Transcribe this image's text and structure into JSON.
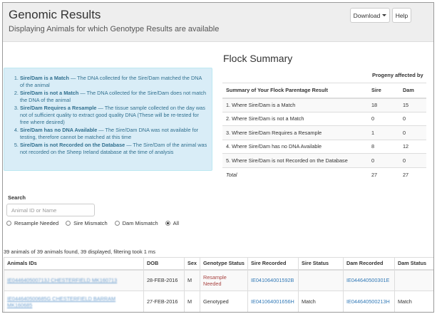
{
  "header": {
    "title": "Genomic Results",
    "subtitle": "Displaying Animals for which Genotype Results are available",
    "download_label": "Download",
    "help_label": "Help"
  },
  "legend": [
    {
      "term": "Sire/Dam is a Match",
      "desc": " — The DNA collected for the Sire/Dam matched the DNA of the animal"
    },
    {
      "term": "Sire/Dam is not a Match",
      "desc": " — The DNA collected for the Sire/Dam does not match the DNA of the animal"
    },
    {
      "term": "Sire/Dam Requires a Resample",
      "desc": " — The tissue sample collected on the day was not of sufficient quality to extract good quality DNA (These will be re-tested for free where desired)"
    },
    {
      "term": "Sire/Dam has no DNA Available",
      "desc": " — The Sire/Dam DNA was not available for testing, therefore cannot be matched at this time"
    },
    {
      "term": "Sire/Dam is not Recorded on the Database",
      "desc": " — The Sire/Dam of the animal was not recorded on the Sheep Ireland database at the time of analysis"
    }
  ],
  "flock_summary": {
    "title": "Flock Summary",
    "progeny_header": "Progeny affected by",
    "col_summary": "Summary of Your Flock Parentage Result",
    "col_sire": "Sire",
    "col_dam": "Dam",
    "rows": [
      {
        "label": "1. Where Sire/Dam is a Match",
        "sire": "18",
        "dam": "15"
      },
      {
        "label": "2. Where Sire/Dam is not a Match",
        "sire": "0",
        "dam": "0"
      },
      {
        "label": "3. Where Sire/Dam Requires a Resample",
        "sire": "1",
        "dam": "0"
      },
      {
        "label": "4. Where Sire/Dam has no DNA Available",
        "sire": "8",
        "dam": "12"
      },
      {
        "label": "5. Where Sire/Dam is not Recorded on the Database",
        "sire": "0",
        "dam": "0"
      }
    ],
    "total": {
      "label": "Total",
      "sire": "27",
      "dam": "27"
    }
  },
  "search": {
    "label": "Search",
    "placeholder": "Animal ID or Name",
    "filters": [
      {
        "label": "Resample Needed",
        "checked": false
      },
      {
        "label": "Sire Mismatch",
        "checked": false
      },
      {
        "label": "Dam Mismatch",
        "checked": false
      },
      {
        "label": "All",
        "checked": true
      }
    ]
  },
  "results": {
    "count_text": "39 animals of 39 animals found, 39 displayed, filtering took 1 ms",
    "columns": [
      "Animals IDs",
      "DOB",
      "Sex",
      "Genotype Status",
      "Sire Recorded",
      "Sire Status",
      "Dam Recorded",
      "Dam Status"
    ],
    "rows": [
      {
        "animal": "IE044640500713J CHESTERFIELD MK160713",
        "dob": "28-FEB-2016",
        "sex": "M",
        "genotype": "Resample Needed",
        "sire": "IE041064001592B",
        "sire_status": "",
        "dam": "IE044640500301E",
        "dam_status": ""
      },
      {
        "animal": "IE044640500685G CHESTERFIELD BARRAM MK160685",
        "dob": "27-FEB-2016",
        "sex": "M",
        "genotype": "Genotyped",
        "sire": "IE041064001656H",
        "sire_status": "Match",
        "dam": "IE044640500213H",
        "dam_status": "Match"
      }
    ]
  }
}
